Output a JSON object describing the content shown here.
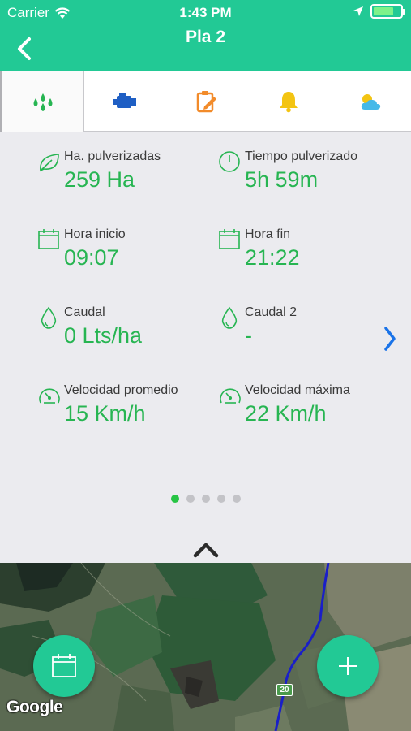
{
  "status_bar": {
    "carrier": "Carrier",
    "time": "1:43 PM"
  },
  "header": {
    "title": "Pla 2",
    "back_icon": "chevron-left-icon"
  },
  "tabs": [
    {
      "name": "drops-icon",
      "active": true,
      "color": "#27b552"
    },
    {
      "name": "engine-icon",
      "active": false,
      "color": "#1f5fc4"
    },
    {
      "name": "clipboard-edit-icon",
      "active": false,
      "color": "#f28b2a"
    },
    {
      "name": "bell-icon",
      "active": false,
      "color": "#f3c412"
    },
    {
      "name": "weather-icon",
      "active": false,
      "color": "#45b9e8"
    }
  ],
  "stats": {
    "ha_pulverizadas": {
      "label": "Ha. pulverizadas",
      "value": "259 Ha",
      "icon": "leaf-icon"
    },
    "tiempo_pulverizado": {
      "label": "Tiempo pulverizado",
      "value": "5h 59m",
      "icon": "clock-icon"
    },
    "hora_inicio": {
      "label": "Hora inicio",
      "value": "09:07",
      "icon": "calendar-icon"
    },
    "hora_fin": {
      "label": "Hora fin",
      "value": "21:22",
      "icon": "calendar-icon"
    },
    "caudal": {
      "label": "Caudal",
      "value": "0 Lts/ha",
      "icon": "drop-icon"
    },
    "caudal_2": {
      "label": "Caudal 2",
      "value": "-",
      "icon": "drop-icon"
    },
    "velocidad_promedio": {
      "label": "Velocidad promedio",
      "value": "15 Km/h",
      "icon": "speedometer-icon"
    },
    "velocidad_maxima": {
      "label": "Velocidad máxima",
      "value": "22 Km/h",
      "icon": "speedometer-icon"
    }
  },
  "pagination": {
    "total": 5,
    "current": 1
  },
  "map": {
    "attribution": "Google",
    "road_label": "20"
  },
  "fabs": {
    "calendar": "calendar-icon",
    "add": "plus-icon"
  },
  "colors": {
    "brand": "#22c995",
    "value_green": "#27b552",
    "accent_blue": "#1a73e8"
  }
}
